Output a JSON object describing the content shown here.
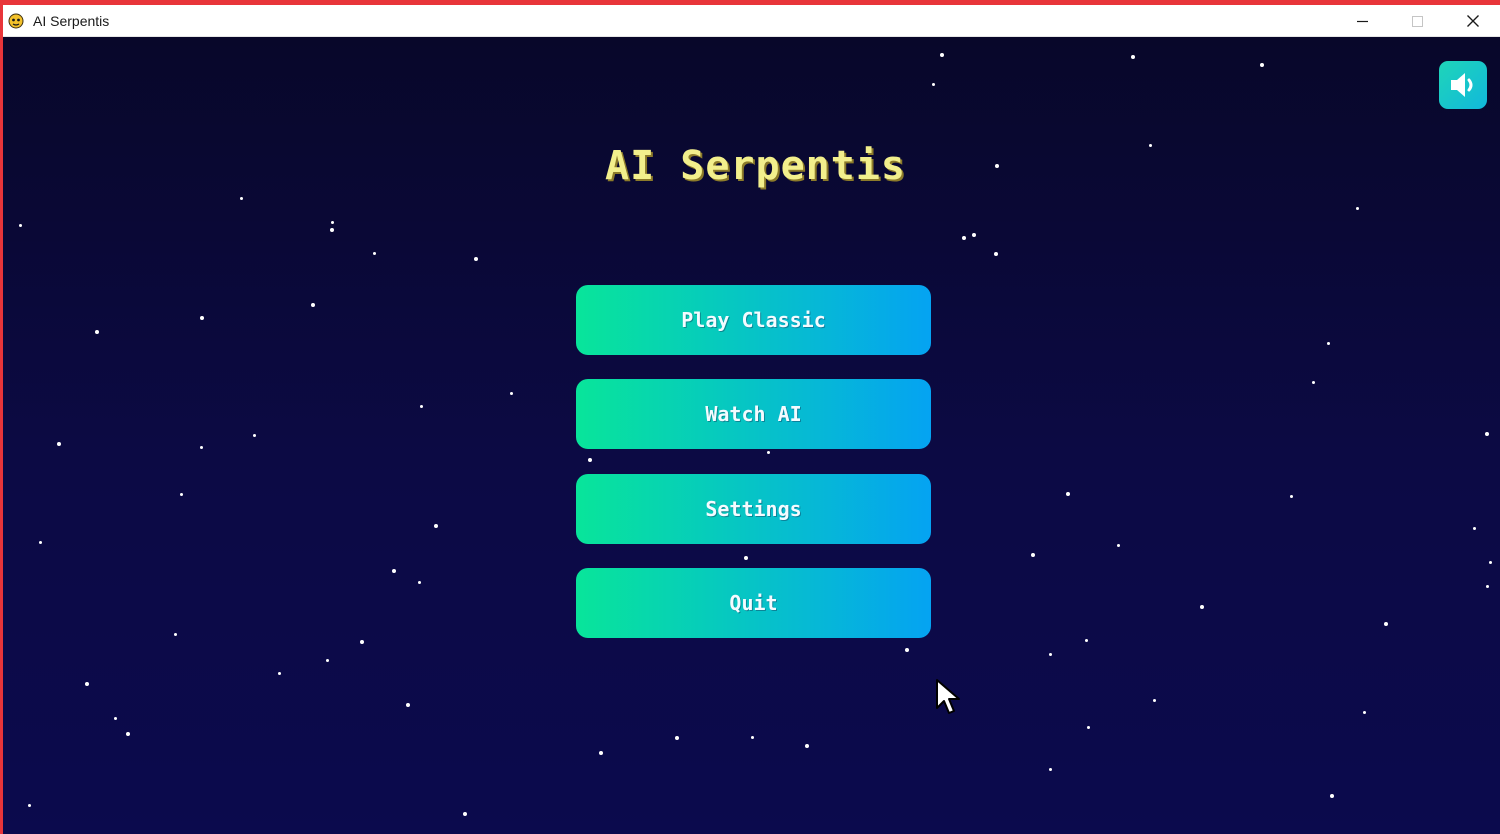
{
  "window": {
    "title": "AI Serpentis"
  },
  "game": {
    "title": "AI Serpentis",
    "menu": [
      {
        "label": "Play Classic"
      },
      {
        "label": "Watch AI"
      },
      {
        "label": "Settings"
      },
      {
        "label": "Quit"
      }
    ],
    "sound_icon": "speaker-on-icon"
  },
  "colors": {
    "accent_start": "#08e59a",
    "accent_end": "#05a3f2",
    "title_color": "#f2ef8c",
    "background": "#0b0930",
    "window_border": "#e8353a"
  }
}
